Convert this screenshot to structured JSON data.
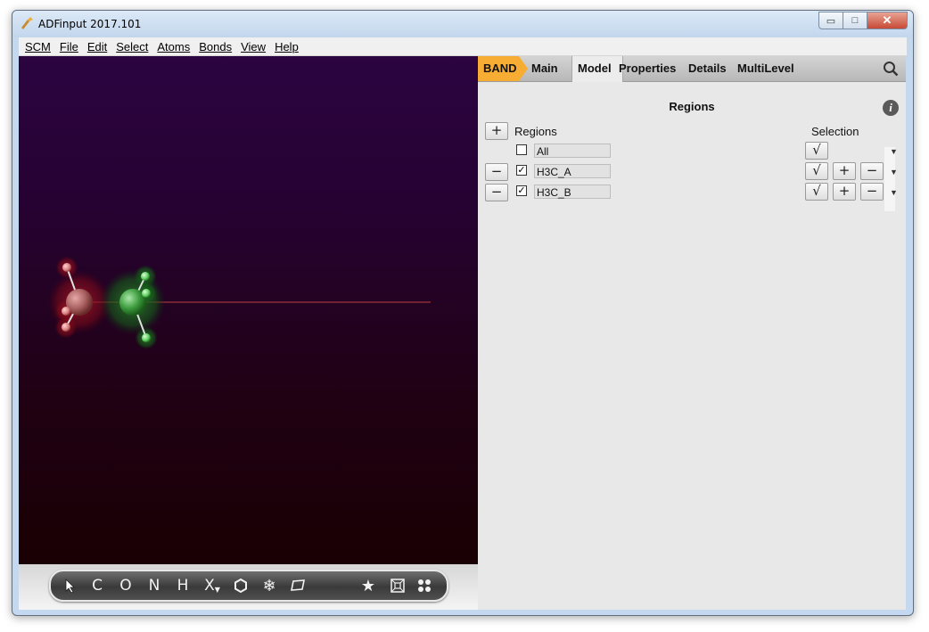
{
  "window": {
    "title": "ADFinput 2017.101",
    "minimize_glyph": "▭",
    "maximize_glyph": "□",
    "close_glyph": "✕"
  },
  "menu": [
    "SCM",
    "File",
    "Edit",
    "Select",
    "Atoms",
    "Bonds",
    "View",
    "Help"
  ],
  "tabs": [
    "BAND",
    "Main",
    "Model",
    "Properties",
    "Details",
    "MultiLevel"
  ],
  "active_tab": "Model",
  "panel": {
    "title": "Regions",
    "info_glyph": "i",
    "add_button": "+",
    "regions_header": "Regions",
    "selection_header": "Selection",
    "regions": [
      {
        "name": "All",
        "checked": false,
        "removable": false,
        "check_mark": "",
        "select_glyph": "√"
      },
      {
        "name": "H3C_A",
        "checked": true,
        "removable": true,
        "check_mark": "✓",
        "select_glyph": "√",
        "add_glyph": "+",
        "remove_glyph": "−",
        "remove_row_glyph": "−"
      },
      {
        "name": "H3C_B",
        "checked": true,
        "removable": true,
        "check_mark": "✓",
        "select_glyph": "√",
        "add_glyph": "+",
        "remove_glyph": "−",
        "remove_row_glyph": "−"
      }
    ],
    "dropdown_glyph": "▼"
  },
  "toolbar": {
    "tools": [
      "pointer-icon",
      "C",
      "O",
      "N",
      "H",
      "X",
      "ring-icon",
      "snowflake-icon",
      "plane-icon",
      "star-icon",
      "box-icon",
      "dots-icon"
    ]
  },
  "colors": {
    "band_tab": "#f7ad33",
    "viewport_top": "#2b0440",
    "viewport_bottom": "#1a0003",
    "region_a_atoms": "#d45050",
    "region_b_atoms": "#3fbf3f"
  }
}
